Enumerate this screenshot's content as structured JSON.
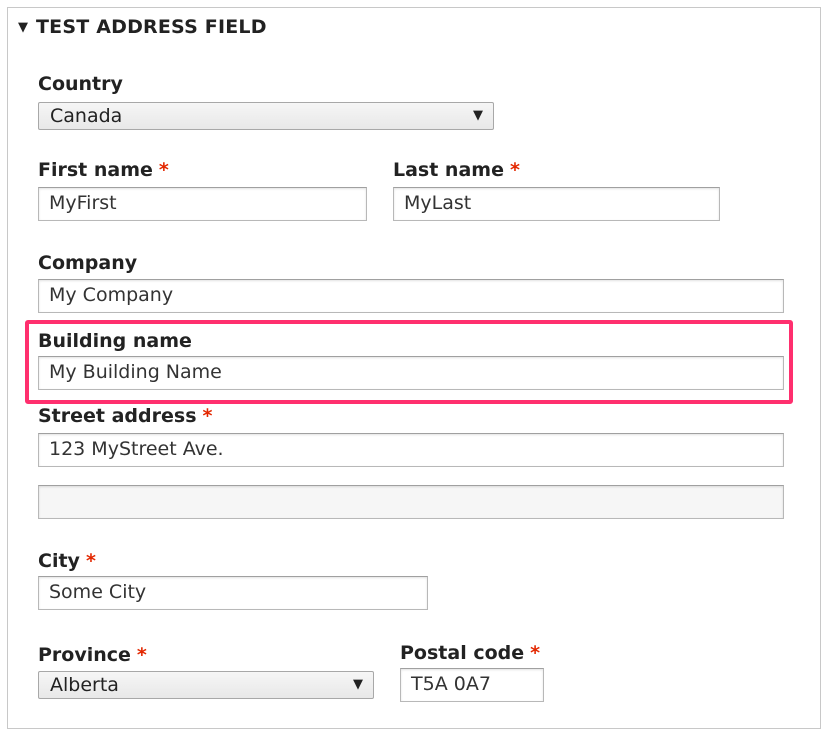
{
  "fieldset": {
    "legend": "TEST ADDRESS FIELD",
    "toggle_glyph": "▼"
  },
  "fields": {
    "country": {
      "label": "Country",
      "value": "Canada"
    },
    "first_name": {
      "label": "First name",
      "value": "MyFirst",
      "required": "*"
    },
    "last_name": {
      "label": "Last name",
      "value": "MyLast",
      "required": "*"
    },
    "company": {
      "label": "Company",
      "value": "My Company"
    },
    "building_name": {
      "label": "Building name",
      "value": "My Building Name"
    },
    "street_address": {
      "label": "Street address",
      "value": "123 MyStreet Ave.",
      "required": "*",
      "line2_value": ""
    },
    "city": {
      "label": "City",
      "value": "Some City",
      "required": "*"
    },
    "province": {
      "label": "Province",
      "value": "Alberta",
      "required": "*"
    },
    "postal_code": {
      "label": "Postal code",
      "value": "T5A 0A7",
      "required": "*"
    }
  },
  "icons": {
    "select_arrow": "▼"
  },
  "colors": {
    "highlight": "#ff2f6e",
    "required": "#e32700"
  }
}
